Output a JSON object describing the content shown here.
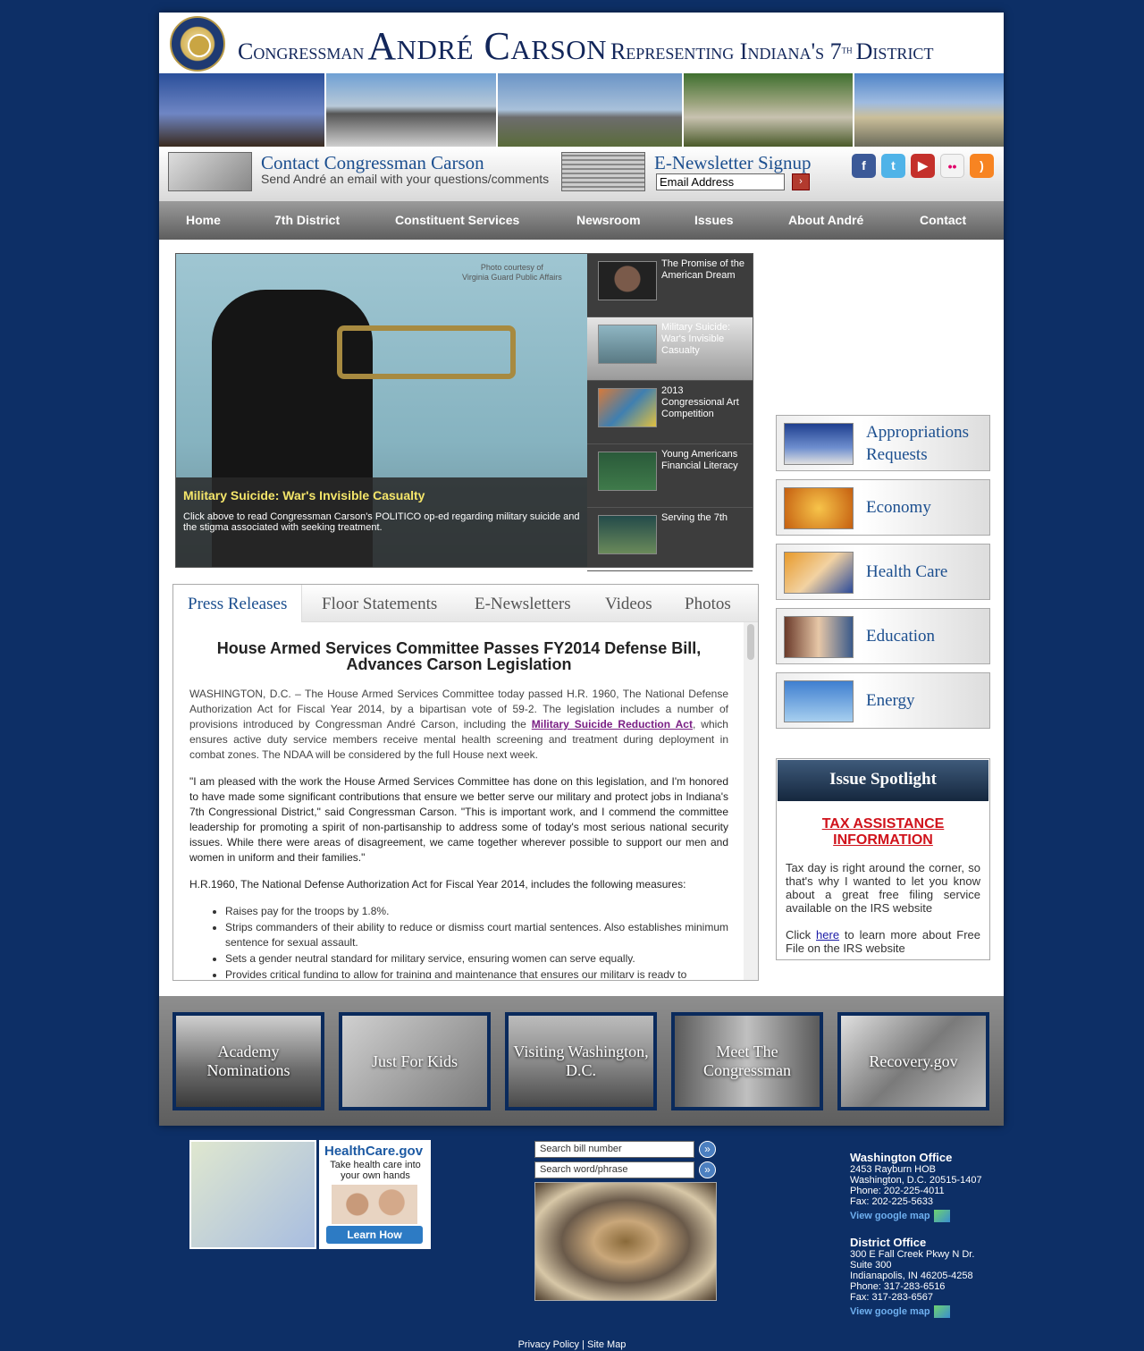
{
  "header": {
    "title_pre": "Congressman",
    "title_name": "André Carson",
    "title_post": "Representing Indiana's 7",
    "title_sup": "th",
    "title_end": "District"
  },
  "contact": {
    "title": "Contact Congressman Carson",
    "subtitle": "Send André an email with your questions/comments"
  },
  "newsletter": {
    "title": "E-Newsletter Signup",
    "email_placeholder": "Email Address"
  },
  "social": [
    {
      "name": "facebook-icon",
      "glyph": "f",
      "color": "#3b5998"
    },
    {
      "name": "twitter-icon",
      "glyph": "t",
      "color": "#4fb3e8"
    },
    {
      "name": "youtube-icon",
      "glyph": "▶",
      "color": "#c4302b"
    },
    {
      "name": "flickr-icon",
      "glyph": "••",
      "color": "#f3f3f3"
    },
    {
      "name": "rss-icon",
      "glyph": ")",
      "color": "#f78422"
    }
  ],
  "nav": [
    "Home",
    "7th District",
    "Constituent Services",
    "Newsroom",
    "Issues",
    "About André",
    "Contact"
  ],
  "slider": {
    "photo_credit": "Photo courtesy of\nVirginia Guard Public Affairs",
    "caption_title": "Military Suicide: War's Invisible Casualty",
    "caption_desc": "Click above to read Congressman Carson's POLITICO op-ed regarding military suicide and the stigma associated with seeking treatment.",
    "items": [
      "The Promise of the American Dream",
      "Military Suicide: War's Invisible Casualty",
      "2013 Congressional Art Competition",
      "Young Americans Financial Literacy",
      "Serving the 7th"
    ]
  },
  "tabs": [
    "Press Releases",
    "Floor Statements",
    "E-Newsletters",
    "Videos",
    "Photos"
  ],
  "article": {
    "headline": "House Armed Services Committee Passes FY2014 Defense Bill, Advances Carson Legislation",
    "p1_a": "WASHINGTON, D.C. – The House Armed Services Committee today passed H.R. 1960, The National Defense Authorization Act for Fiscal Year 2014, by a bipartisan vote of 59-2.  The legislation includes a number of provisions introduced by Congressman André Carson, including the ",
    "p1_link": "Military Suicide Reduction Act",
    "p1_b": ", which ensures active duty service members receive mental health screening and treatment during deployment in combat zones.  The NDAA will be considered by the full House next week.",
    "p2": "\"I am pleased with the work the House Armed Services Committee has done on this legislation, and I'm honored to have made some significant contributions that ensure we better serve our military and protect jobs in Indiana's 7th Congressional District,\" said Congressman Carson.  \"This is important work, and I commend the committee leadership for promoting a spirit of non-partisanship to address some of today's most serious national security issues. While there were areas of disagreement, we came together wherever possible to support our men and women in uniform and their families.\"",
    "p3": "H.R.1960, The National Defense Authorization Act for Fiscal Year 2014, includes the following measures:",
    "bullets": [
      "Raises pay for the troops by 1.8%.",
      "Strips commanders of their ability to reduce or dismiss court martial sentences.  Also establishes minimum sentence for sexual assault.",
      "Sets a gender neutral standard for military service, ensuring women can serve equally.",
      "Provides critical funding to allow for training and maintenance that ensures our military is ready to"
    ]
  },
  "issues": [
    "Appropriations Requests",
    "Economy",
    "Health Care",
    "Education",
    "Energy"
  ],
  "spotlight": {
    "heading": "Issue Spotlight",
    "title": "TAX ASSISTANCE INFORMATION",
    "p1": "Tax day is right around the corner, so that's why I wanted to let you know about a great free filing service available on the IRS website",
    "p2_a": "Click ",
    "p2_link": "here",
    "p2_b": " to learn more about Free File on the IRS website"
  },
  "features": [
    "Academy Nominations",
    "Just For Kids",
    "Visiting Washington, D.C.",
    "Meet The Congressman",
    "Recovery.gov"
  ],
  "healthcare": {
    "logo": "HealthCare.gov",
    "tagline": "Take health care into your own hands",
    "button": "Learn How"
  },
  "search": {
    "bill_placeholder": "Search bill number",
    "word_placeholder": "Search word/phrase",
    "go": "»"
  },
  "offices": [
    {
      "name": "Washington Office",
      "lines": [
        "2453 Rayburn HOB",
        "Washington, D.C. 20515-1407",
        "Phone: 202-225-4011",
        "Fax: 202-225-5633"
      ],
      "map": "View google map"
    },
    {
      "name": "District Office",
      "lines": [
        "300 E Fall Creek Pkwy N Dr.",
        "Suite 300",
        "Indianapolis, IN 46205-4258",
        "Phone: 317-283-6516",
        "Fax: 317-283-6567"
      ],
      "map": "View google map"
    }
  ],
  "footer": {
    "privacy": "Privacy Policy",
    "sep": "|",
    "sitemap": "Site Map"
  }
}
